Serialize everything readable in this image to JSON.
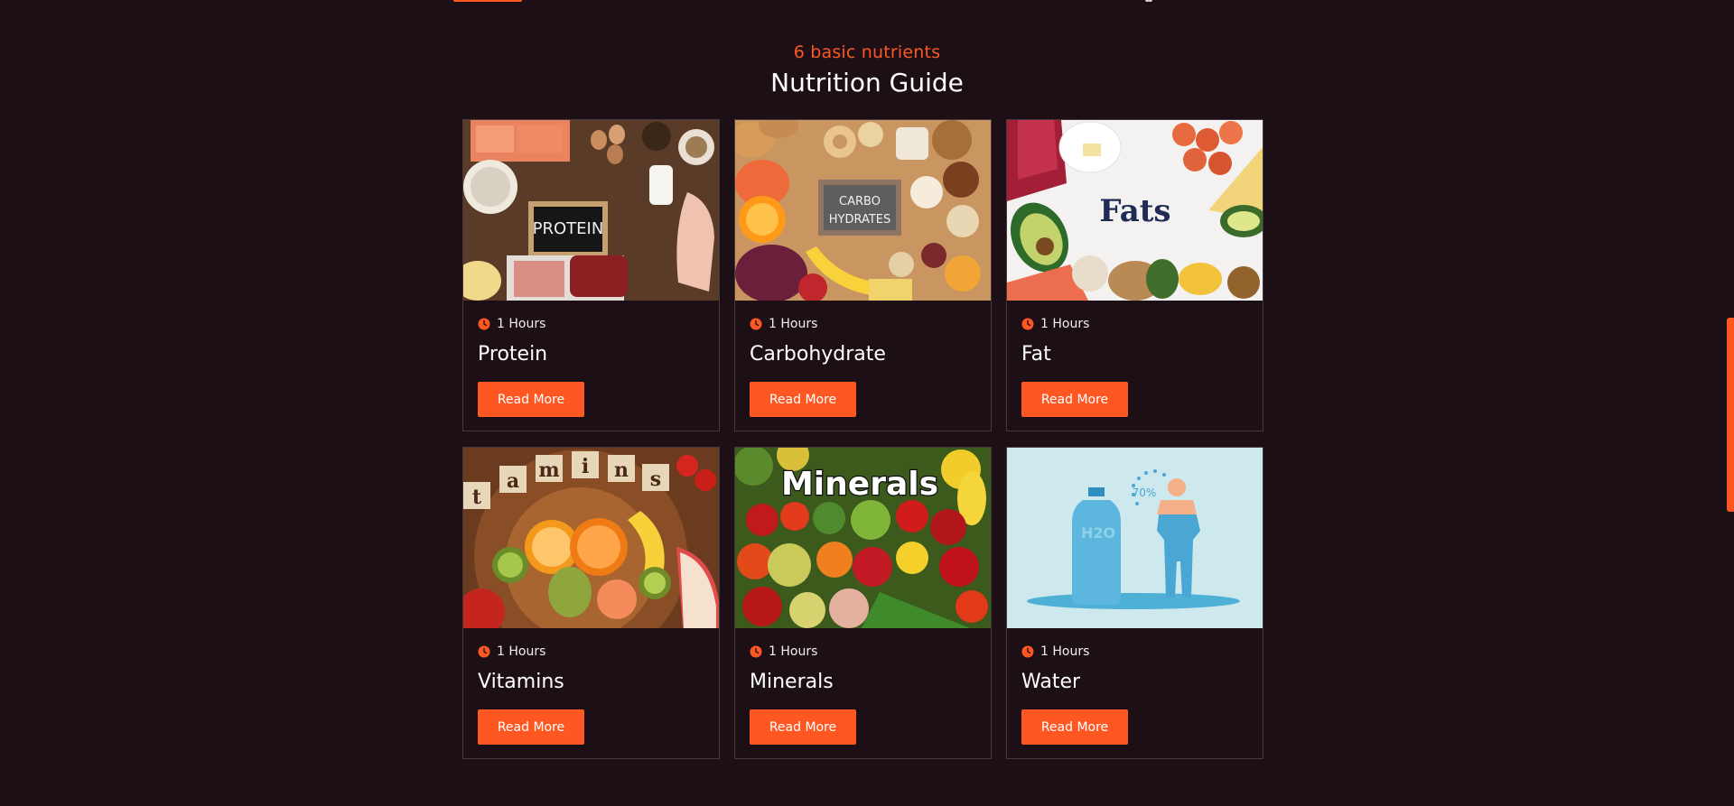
{
  "section": {
    "eyebrow": "6 basic nutrients",
    "title": "Nutrition Guide"
  },
  "cards": [
    {
      "duration": "1 Hours",
      "title": "Protein",
      "button": "Read More",
      "image_label": "PROTEIN"
    },
    {
      "duration": "1 Hours",
      "title": "Carbohydrate",
      "button": "Read More",
      "image_label": "CARBO HYDRATES"
    },
    {
      "duration": "1 Hours",
      "title": "Fat",
      "button": "Read More",
      "image_label": "Fats"
    },
    {
      "duration": "1 Hours",
      "title": "Vitamins",
      "button": "Read More",
      "image_label": "Vitamins"
    },
    {
      "duration": "1 Hours",
      "title": "Minerals",
      "button": "Read More",
      "image_label": "Minerals"
    },
    {
      "duration": "1 Hours",
      "title": "Water",
      "button": "Read More",
      "image_label": "H2O 70%"
    }
  ],
  "colors": {
    "background": "#1c1016",
    "accent": "#ff5722",
    "card_border": "#47373f",
    "text": "#ffffff"
  },
  "icons": {
    "duration": "clock-icon"
  }
}
